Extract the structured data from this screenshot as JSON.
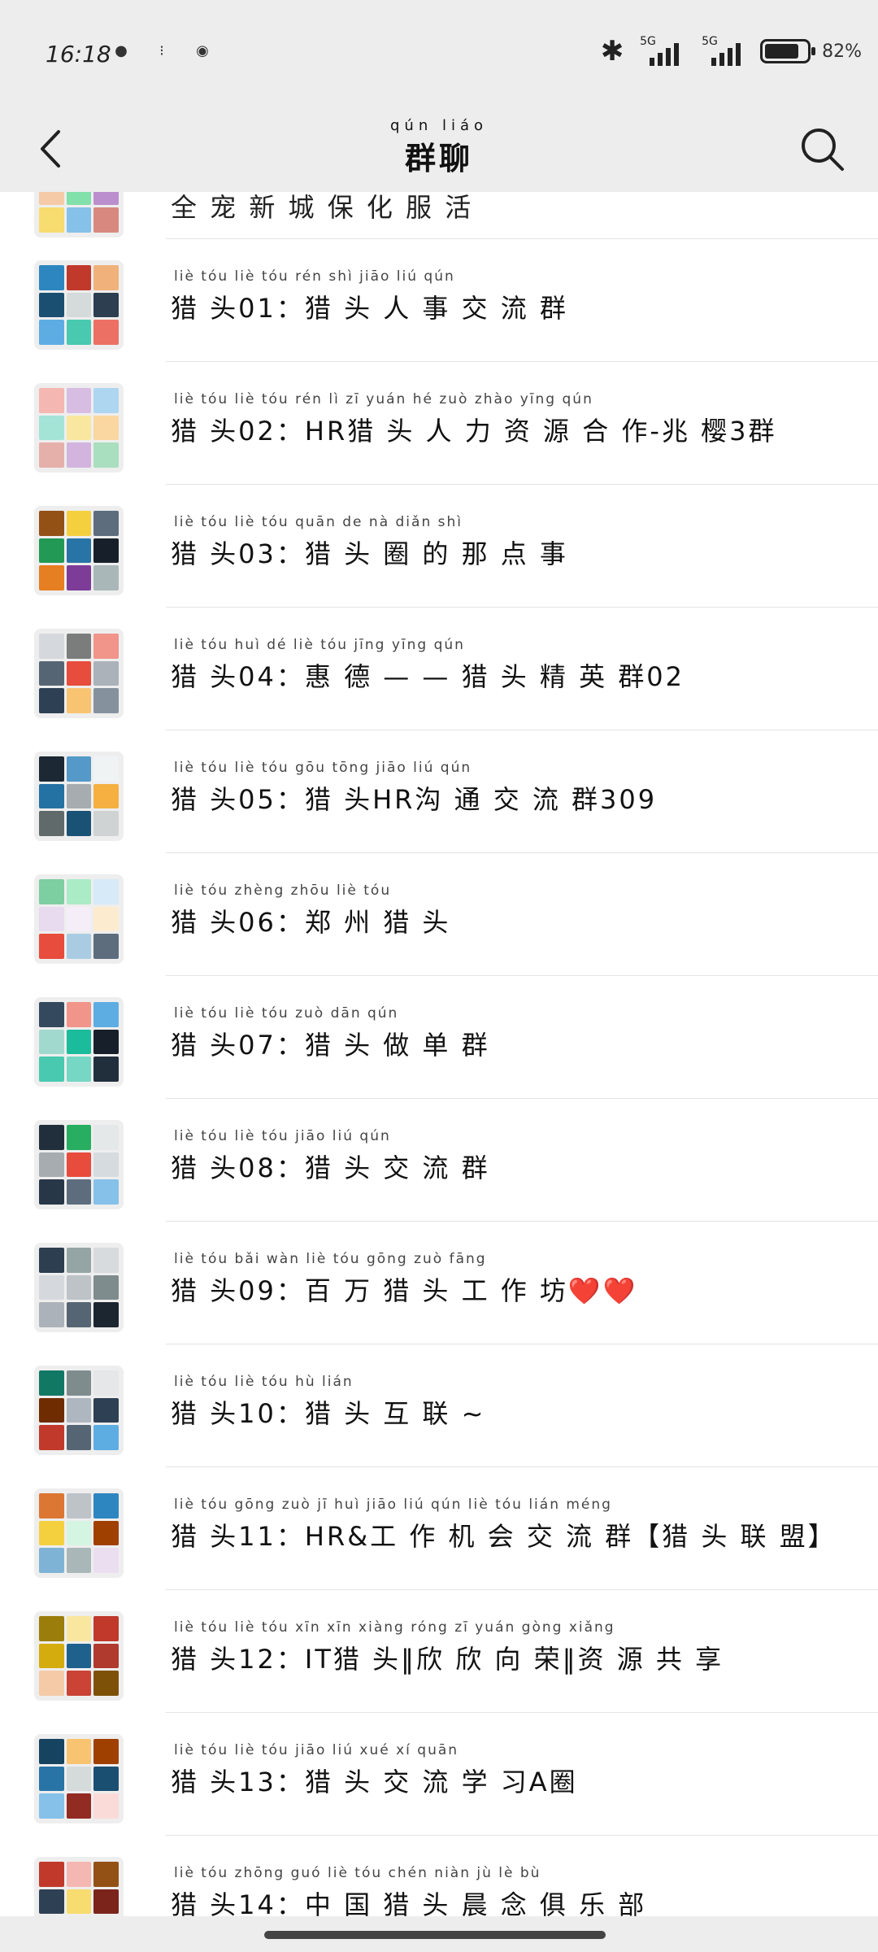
{
  "status_bar": {
    "time": "16:18",
    "network_1": "5G",
    "network_2": "5G",
    "battery_percent": 82,
    "battery_text": "82%"
  },
  "header": {
    "title_pinyin": "qún liáo",
    "title": "群聊",
    "back_icon": "back-chevron-icon",
    "search_icon": "search-icon"
  },
  "groups": [
    {
      "name": "全 宠 新 城 保 化 服 活",
      "pinyin": ""
    },
    {
      "name": "猎 头01：猎 头 人 事 交 流 群",
      "pinyin": "liè tóu      liè tóu rén shì jiāo liú qún"
    },
    {
      "name": "猎 头02：HR猎 头 人 力 资 源 合 作-兆 樱3群",
      "pinyin": "liè tóu         liè tóu rén  lì  zī yuán hé zuò  zhào yīng   qún"
    },
    {
      "name": "猎 头03：猎 头 圈 的 那 点 事",
      "pinyin": "liè tóu      liè tóu quān de  nà diǎn shì"
    },
    {
      "name": "猎 头04：惠 德 — — 猎 头 精 英 群02",
      "pinyin": "liè tóu      huì  dé           liè tóu jīng yīng qún"
    },
    {
      "name": "猎 头05：猎 头HR沟 通 交 流 群309",
      "pinyin": "liè tóu      liè tóu     gōu tōng jiāo liú qún"
    },
    {
      "name": "猎 头06：郑 州 猎 头",
      "pinyin": "liè tóu    zhèng zhōu liè tóu"
    },
    {
      "name": "猎 头07：猎 头 做 单 群",
      "pinyin": "liè tóu      liè tóu zuò dān qún"
    },
    {
      "name": "猎 头08：猎 头 交 流 群",
      "pinyin": "liè tóu      liè tóu jiāo liú qún"
    },
    {
      "name": "猎 头09：百 万 猎 头 工 作 坊❤️❤️",
      "pinyin": "liè tóu      bǎi wàn liè tóu gōng zuò fāng"
    },
    {
      "name": "猎 头10：猎 头 互 联 ~",
      "pinyin": "liè tóu      liè tóu hù lián"
    },
    {
      "name": "猎 头11：HR&工 作 机 会 交 流 群【猎 头 联 盟】",
      "pinyin": "liè tóu          gōng zuò  jī  huì jiāo liú qún     liè tóu lián méng"
    },
    {
      "name": "猎 头12：IT猎 头‖欣 欣 向 荣‖资 源 共 享",
      "pinyin": "liè tóu        liè tóu      xīn xīn xiàng róng    zī yuán gòng xiǎng"
    },
    {
      "name": "猎 头13：猎 头 交 流 学 习A圈",
      "pinyin": "liè tóu      liè tóu jiāo liú xué  xí    quān"
    },
    {
      "name": "猎 头14：中 国 猎 头 晨 念 俱 乐 部",
      "pinyin": "liè tóu    zhōng guó liè tóu chén niàn jù  lè  bù"
    }
  ],
  "avatar_palettes": [
    [
      "#7fb3d5",
      "#a9cce3",
      "#d4e6f1",
      "#f5cba7",
      "#82e0aa",
      "#bb8fce",
      "#f7dc6f",
      "#85c1e9",
      "#d98880"
    ],
    [
      "#2e86c1",
      "#c0392b",
      "#f0b27a",
      "#1b4f72",
      "#d5dbdb",
      "#2c3e50",
      "#5dade2",
      "#48c9b0",
      "#ec7063"
    ],
    [
      "#f5b7b1",
      "#d7bde2",
      "#aed6f1",
      "#a3e4d7",
      "#f9e79f",
      "#fad7a0",
      "#e6b0aa",
      "#d2b4de",
      "#a9dfbf"
    ],
    [
      "#935116",
      "#f4d03f",
      "#5d6d7e",
      "#229954",
      "#2874a6",
      "#17202a",
      "#e67e22",
      "#7d3c98",
      "#aab7b8"
    ],
    [
      "#d5d8dc",
      "#7b7d7d",
      "#f1948a",
      "#566573",
      "#e74c3c",
      "#abb2b9",
      "#2e4053",
      "#f8c471",
      "#85929e"
    ],
    [
      "#1c2833",
      "#5499c7",
      "#f0f3f4",
      "#2471a3",
      "#a6acaf",
      "#f5b041",
      "#616a6b",
      "#1a5276",
      "#d0d3d4"
    ],
    [
      "#7dcea0",
      "#abebc6",
      "#d6eaf8",
      "#e8daef",
      "#f5eef8",
      "#fdebd0",
      "#e74c3c",
      "#a9cce3",
      "#5d6d7e"
    ],
    [
      "#34495e",
      "#f1948a",
      "#5dade2",
      "#a2d9ce",
      "#1abc9c",
      "#17202a",
      "#48c9b0",
      "#76d7c4",
      "#212f3d"
    ],
    [
      "#212f3c",
      "#27ae60",
      "#e5e8e8",
      "#a6acaf",
      "#e74c3c",
      "#d6dbdf",
      "#283747",
      "#5d6d7e",
      "#85c1e9"
    ],
    [
      "#2c3e50",
      "#95a5a6",
      "#d7dbdd",
      "#d5d8dc",
      "#bdc3c7",
      "#7f8c8d",
      "#abb2b9",
      "#566573",
      "#1b2631"
    ],
    [
      "#117864",
      "#7f8c8d",
      "#e5e7e9",
      "#6e2c00",
      "#aeb6bf",
      "#2e4053",
      "#c0392b",
      "#566573",
      "#5dade2"
    ],
    [
      "#dc7633",
      "#bdc3c7",
      "#2e86c1",
      "#f4d03f",
      "#d5f5e3",
      "#a04000",
      "#7fb3d5",
      "#aab7b8",
      "#ebdef0"
    ],
    [
      "#9a7d0a",
      "#f9e79f",
      "#c0392b",
      "#d4ac0d",
      "#1f618d",
      "#b03a2e",
      "#f5cba7",
      "#cb4335",
      "#7e5109"
    ],
    [
      "#154360",
      "#f8c471",
      "#a04000",
      "#2874a6",
      "#d5dbdb",
      "#1b4f72",
      "#85c1e9",
      "#922b21",
      "#fadbd8"
    ],
    [
      "#c0392b",
      "#f5b7b1",
      "#935116",
      "#2e4053",
      "#f7dc6f",
      "#7b241c",
      "#d35400",
      "#5d6d7e",
      "#fdebd0"
    ]
  ]
}
